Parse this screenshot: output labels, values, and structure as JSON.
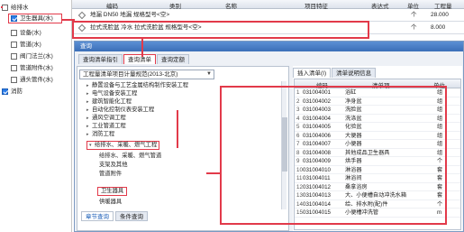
{
  "left_tree": {
    "items": [
      {
        "label": "给排水",
        "checked": false
      },
      {
        "label": "卫生器具(水)",
        "checked": true
      },
      {
        "label": "设备(水)",
        "checked": false
      },
      {
        "label": "管道(水)",
        "checked": false
      },
      {
        "label": "阀门法兰(水)",
        "checked": false
      },
      {
        "label": "管道附件(水)",
        "checked": false
      },
      {
        "label": "通头管件(水)",
        "checked": false
      },
      {
        "label": "消防",
        "checked": true
      }
    ]
  },
  "top_table": {
    "headers": [
      "编码",
      "类别",
      "名称",
      "项目特征",
      "表达式",
      "单位",
      "工程量"
    ],
    "rows": [
      {
        "name": "地漏 DN50 地漏 规格型号<空>",
        "unit": "个",
        "qty": "28.000"
      },
      {
        "name": "拉式洗脸盆 冷水 拉式洗脸盆 规格型号<空>",
        "unit": "个",
        "qty": "8.000"
      }
    ]
  },
  "dialog": {
    "title": "查询",
    "tabs": [
      "查询清单指引",
      "查询清单",
      "查询定额"
    ],
    "active_tab": 1,
    "combo_value": "工程量清单项目计量规范(2013-北京)",
    "tree": [
      {
        "label": "静置设备与工艺金属结构制作安装工程",
        "level": 1,
        "toggle": "▸"
      },
      {
        "label": "电气设备安装工程",
        "level": 1,
        "toggle": "▸"
      },
      {
        "label": "建筑智能化工程",
        "level": 1,
        "toggle": "▸"
      },
      {
        "label": "自动化控制仪表安装工程",
        "level": 1,
        "toggle": "▸"
      },
      {
        "label": "通风空调工程",
        "level": 1,
        "toggle": "▸"
      },
      {
        "label": "工业管道工程",
        "level": 1,
        "toggle": "▸"
      },
      {
        "label": "消防工程",
        "level": 1,
        "toggle": "▸"
      },
      {
        "label": "给排水、采暖、燃气工程",
        "level": 1,
        "toggle": "▾"
      },
      {
        "label": "给排水、采暖、燃气管道",
        "level": 2,
        "toggle": ""
      },
      {
        "label": "支架及其他",
        "level": 2,
        "toggle": ""
      },
      {
        "label": "管道附件",
        "level": 2,
        "toggle": ""
      },
      {
        "label": "卫生器具",
        "level": 2,
        "toggle": ""
      },
      {
        "label": "供暖器具",
        "level": 2,
        "toggle": ""
      }
    ],
    "bottom_tabs": [
      "章节查询",
      "条件查询"
    ],
    "right_tabs": [
      "插入清单(I)",
      "清单说明信息"
    ],
    "grid": {
      "headers": [
        "编码",
        "清单项",
        "单位"
      ],
      "rows": [
        {
          "code": "031004001",
          "name": "浴缸",
          "unit": "组"
        },
        {
          "code": "031004002",
          "name": "净身盆",
          "unit": "组"
        },
        {
          "code": "031004003",
          "name": "洗脸盆",
          "unit": "组"
        },
        {
          "code": "031004004",
          "name": "洗涤盆",
          "unit": "组"
        },
        {
          "code": "031004005",
          "name": "化验盆",
          "unit": "组"
        },
        {
          "code": "031004006",
          "name": "大便器",
          "unit": "组"
        },
        {
          "code": "031004007",
          "name": "小便器",
          "unit": "组"
        },
        {
          "code": "031004008",
          "name": "其他成品卫生器具",
          "unit": "组"
        },
        {
          "code": "031004009",
          "name": "烘手器",
          "unit": "个"
        },
        {
          "code": "031004010",
          "name": "淋浴器",
          "unit": "套"
        },
        {
          "code": "031004011",
          "name": "淋浴间",
          "unit": "套"
        },
        {
          "code": "031004012",
          "name": "桑拿浴房",
          "unit": "套"
        },
        {
          "code": "031004013",
          "name": "大、小便槽自动冲洗水箱",
          "unit": "套"
        },
        {
          "code": "031004014",
          "name": "给、排水附(配)件",
          "unit": "个"
        },
        {
          "code": "031004015",
          "name": "小便槽冲洗管",
          "unit": "m"
        }
      ]
    }
  }
}
